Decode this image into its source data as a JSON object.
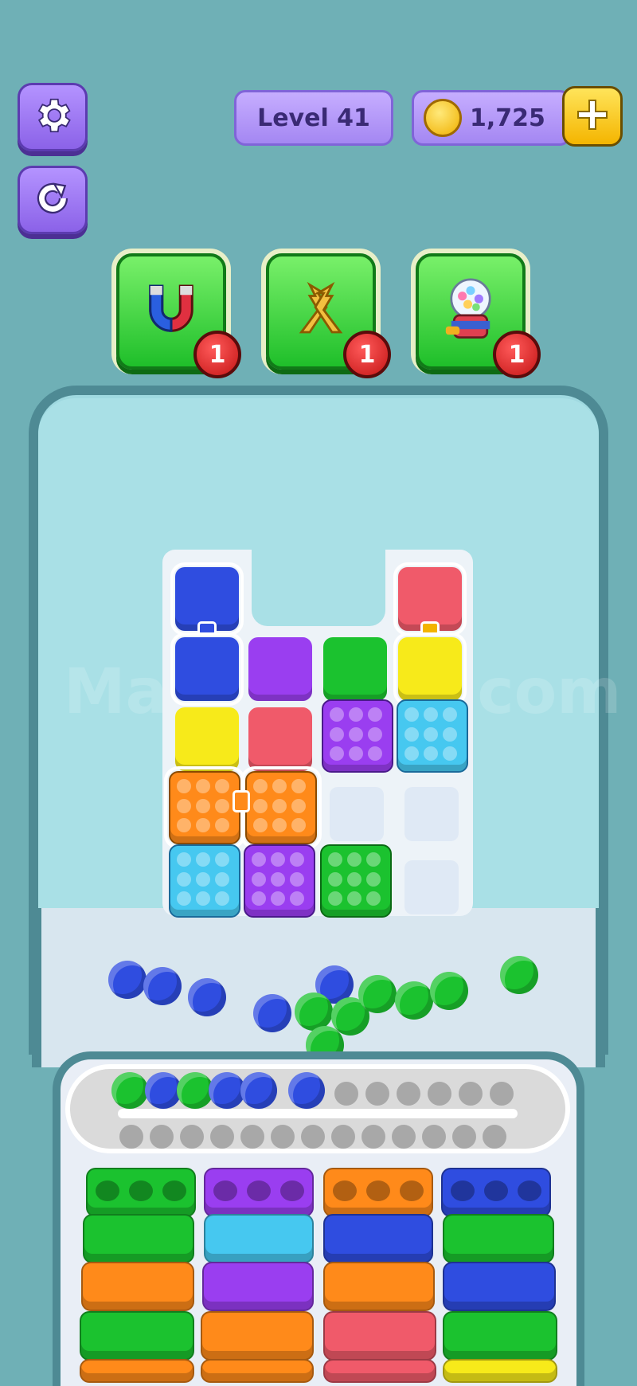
{
  "header": {
    "level_label": "Level 41",
    "coins": "1,725"
  },
  "boosters": [
    {
      "name": "magnet",
      "count": "1"
    },
    {
      "name": "arrows",
      "count": "1"
    },
    {
      "name": "gumball-machine",
      "count": "1"
    }
  ],
  "watermark": "MarbleSort.com",
  "colors": {
    "blue": "#2f4de0",
    "purple": "#9a3ef0",
    "green": "#1bc22f",
    "red": "#f05a6a",
    "yellow": "#f7ea1a",
    "cyan": "#46c8f0",
    "orange": "#ff8a1a"
  }
}
